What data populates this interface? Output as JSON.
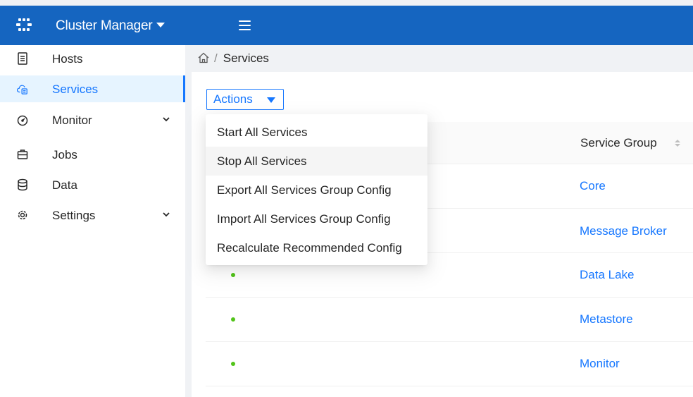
{
  "header": {
    "app_title": "Cluster Manager"
  },
  "sidebar": {
    "items": [
      {
        "label": "Hosts",
        "icon": "hosts-icon"
      },
      {
        "label": "Services",
        "icon": "cloud-services-icon",
        "active": true
      },
      {
        "label": "Monitor",
        "icon": "gauge-icon",
        "expandable": true
      },
      {
        "label": "Jobs",
        "icon": "briefcase-icon"
      },
      {
        "label": "Data",
        "icon": "database-icon"
      },
      {
        "label": "Settings",
        "icon": "gear-icon",
        "expandable": true
      }
    ]
  },
  "breadcrumb": {
    "separator": "/",
    "current": "Services"
  },
  "actions": {
    "label": "Actions",
    "menu": [
      "Start All Services",
      "Stop All Services",
      "Export All Services Group Config",
      "Import All Services Group Config",
      "Recalculate Recommended Config"
    ],
    "hovered_index": 1
  },
  "table": {
    "columns": {
      "service_group": "Service Group"
    },
    "rows": [
      {
        "status": "running",
        "service_group": "Core"
      },
      {
        "status": "running",
        "service_group": "Message Broker"
      },
      {
        "status": "running",
        "service_group": "Data Lake"
      },
      {
        "status": "running",
        "service_group": "Metastore"
      },
      {
        "status": "running",
        "service_group": "Monitor"
      }
    ]
  },
  "colors": {
    "header_bg": "#1565c0",
    "accent": "#1677ff",
    "status_running": "#52c41a",
    "active_nav_bg": "#e6f4ff"
  }
}
